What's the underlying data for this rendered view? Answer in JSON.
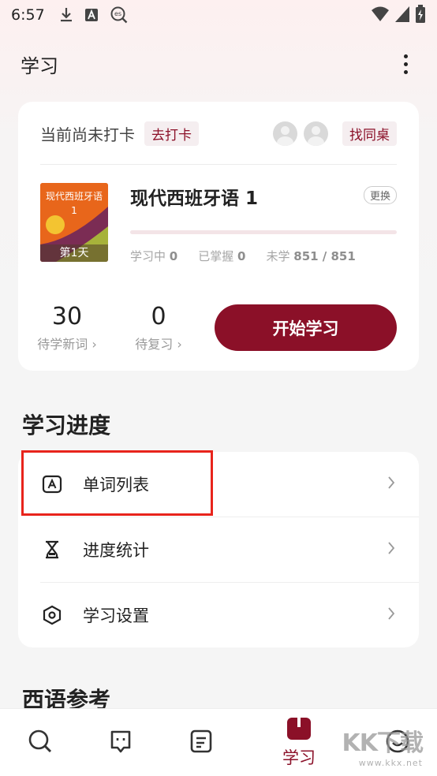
{
  "status_bar": {
    "time": "6:57",
    "icons": [
      "download-icon",
      "a-box-icon",
      "es-search-icon",
      "wifi-icon",
      "signal-icon",
      "battery-charging-icon"
    ]
  },
  "app_bar": {
    "title": "学习",
    "more_icon": "more-vertical-icon"
  },
  "checkin": {
    "status": "当前尚未打卡",
    "checkin_button": "去打卡",
    "find_partner_button": "找同桌"
  },
  "book": {
    "cover_title": "现代西班牙语 1",
    "cover_day": "第1天",
    "name": "现代西班牙语 1",
    "change_button": "更换",
    "progress": 0,
    "stats": {
      "learning_label": "学习中",
      "learning_value": "0",
      "mastered_label": "已掌握",
      "mastered_value": "0",
      "unlearned_label": "未学",
      "unlearned_value": "851 / 851"
    }
  },
  "counters": {
    "new_words_value": "30",
    "new_words_label": "待学新词 ›",
    "review_value": "0",
    "review_label": "待复习 ›"
  },
  "start_button": "开始学习",
  "progress_section": {
    "title": "学习进度",
    "items": [
      {
        "label": "单词列表",
        "icon": "word-list-icon"
      },
      {
        "label": "进度统计",
        "icon": "hourglass-icon"
      },
      {
        "label": "学习设置",
        "icon": "settings-hexagon-icon"
      }
    ]
  },
  "reference_section": {
    "title": "西语参考"
  },
  "tab_bar": {
    "tabs": [
      {
        "icon": "search-icon"
      },
      {
        "icon": "chat-face-icon"
      },
      {
        "icon": "notes-icon"
      },
      {
        "icon": "study-book-icon",
        "label": "学习",
        "active": true
      },
      {
        "icon": "smile-icon"
      }
    ],
    "active_color": "#8b1028"
  },
  "watermark": {
    "text": "KK下载",
    "url_text": "www.kkx.net"
  },
  "colors": {
    "accent": "#8b1028",
    "highlight_box": "#e8241c"
  }
}
